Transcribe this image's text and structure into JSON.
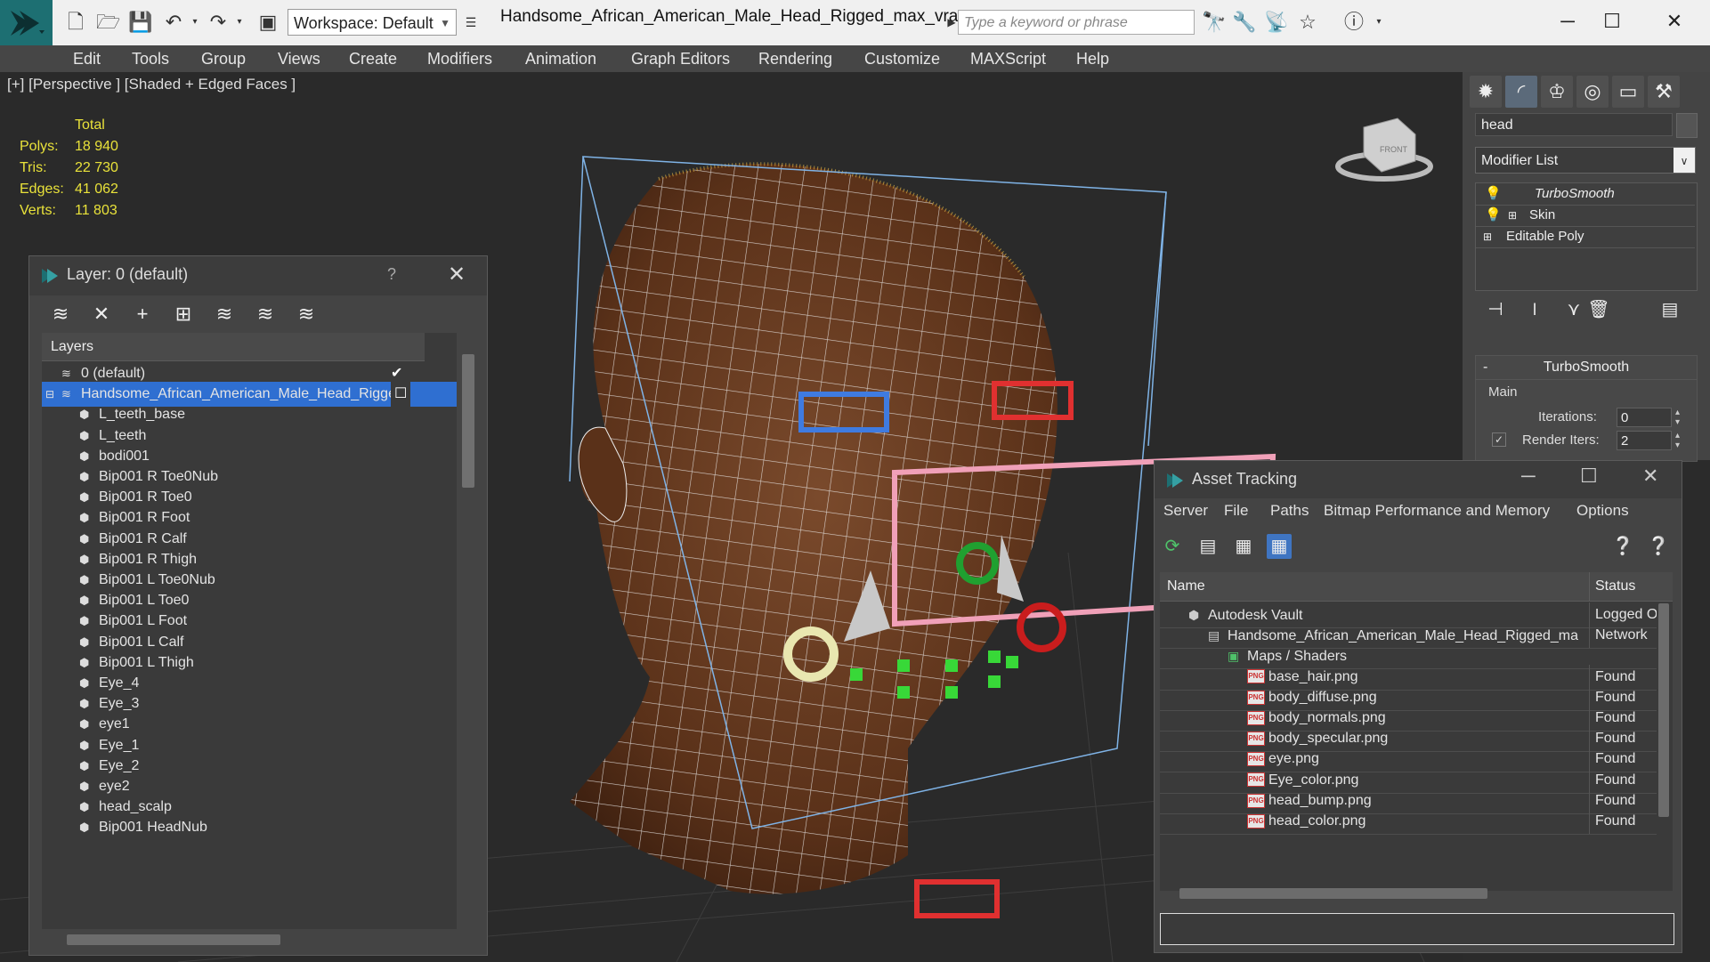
{
  "titlebar": {
    "workspace": "Workspace: Default",
    "doc_title": "Handsome_African_American_Male_Head_Rigged_max_vray...",
    "search_placeholder": "Type a keyword or phrase"
  },
  "menu": [
    "Edit",
    "Tools",
    "Group",
    "Views",
    "Create",
    "Modifiers",
    "Animation",
    "Graph Editors",
    "Rendering",
    "Customize",
    "MAXScript",
    "Help"
  ],
  "viewport": {
    "label": "[+] [Perspective ] [Shaded + Edged Faces ]",
    "stats_header": "Total",
    "stats": [
      {
        "k": "Polys:",
        "v": "18 940"
      },
      {
        "k": "Tris:",
        "v": "22 730"
      },
      {
        "k": "Edges:",
        "v": "41 062"
      },
      {
        "k": "Verts:",
        "v": "11 803"
      }
    ],
    "viewcube_label": "FRONT"
  },
  "layer_panel": {
    "title": "Layer: 0 (default)",
    "help": "?",
    "column_header": "Layers",
    "rows": [
      {
        "label": "0 (default)",
        "level": 1,
        "selected": false,
        "checked": true
      },
      {
        "label": "Handsome_African_American_Male_Head_Rigged",
        "level": 1,
        "selected": true,
        "checked": false
      },
      {
        "label": "L_teeth_base",
        "level": 2
      },
      {
        "label": "L_teeth",
        "level": 2
      },
      {
        "label": "bodi001",
        "level": 2
      },
      {
        "label": "Bip001 R Toe0Nub",
        "level": 2
      },
      {
        "label": "Bip001 R Toe0",
        "level": 2
      },
      {
        "label": "Bip001 R Foot",
        "level": 2
      },
      {
        "label": "Bip001 R Calf",
        "level": 2
      },
      {
        "label": "Bip001 R Thigh",
        "level": 2
      },
      {
        "label": "Bip001 L Toe0Nub",
        "level": 2
      },
      {
        "label": "Bip001 L Toe0",
        "level": 2
      },
      {
        "label": "Bip001 L Foot",
        "level": 2
      },
      {
        "label": "Bip001 L Calf",
        "level": 2
      },
      {
        "label": "Bip001 L Thigh",
        "level": 2
      },
      {
        "label": "Eye_4",
        "level": 2
      },
      {
        "label": "Eye_3",
        "level": 2
      },
      {
        "label": "eye1",
        "level": 2
      },
      {
        "label": "Eye_1",
        "level": 2
      },
      {
        "label": "Eye_2",
        "level": 2
      },
      {
        "label": "eye2",
        "level": 2
      },
      {
        "label": "head_scalp",
        "level": 2
      },
      {
        "label": "Bip001 HeadNub",
        "level": 2
      }
    ]
  },
  "cmdpanel": {
    "object_name": "head",
    "modifier_list": "Modifier List",
    "stack": [
      "TurboSmooth",
      "Skin",
      "Editable Poly"
    ],
    "rollout_title": "TurboSmooth",
    "group_main": "Main",
    "iterations_label": "Iterations:",
    "iterations_value": "0",
    "render_iters_label": "Render Iters:",
    "render_iters_value": "2"
  },
  "asset_tracking": {
    "title": "Asset Tracking",
    "menu": [
      "Server",
      "File",
      "Paths",
      "Bitmap Performance and Memory",
      "Options"
    ],
    "col_name": "Name",
    "col_status": "Status",
    "rows": [
      {
        "name": "Autodesk Vault",
        "status": "Logged Out",
        "indent": 1,
        "icon": "vault"
      },
      {
        "name": "Handsome_African_American_Male_Head_Rigged_max_vray.max",
        "status": "Network",
        "indent": 2,
        "icon": "max"
      },
      {
        "name": "Maps / Shaders",
        "status": "",
        "indent": 3,
        "icon": "maps"
      },
      {
        "name": "base_hair.png",
        "status": "Found",
        "indent": 4,
        "icon": "png"
      },
      {
        "name": "body_diffuse.png",
        "status": "Found",
        "indent": 4,
        "icon": "png"
      },
      {
        "name": "body_normals.png",
        "status": "Found",
        "indent": 4,
        "icon": "png"
      },
      {
        "name": "body_specular.png",
        "status": "Found",
        "indent": 4,
        "icon": "png"
      },
      {
        "name": "eye.png",
        "status": "Found",
        "indent": 4,
        "icon": "png"
      },
      {
        "name": "Eye_color.png",
        "status": "Found",
        "indent": 4,
        "icon": "png"
      },
      {
        "name": "head_bump.png",
        "status": "Found",
        "indent": 4,
        "icon": "png"
      },
      {
        "name": "head_color.png",
        "status": "Found",
        "indent": 4,
        "icon": "png"
      }
    ]
  },
  "colors": {
    "stats_yellow": "#e9e23a",
    "selection_blue": "#2f6fd1",
    "logo_teal": "#1d6f72"
  }
}
